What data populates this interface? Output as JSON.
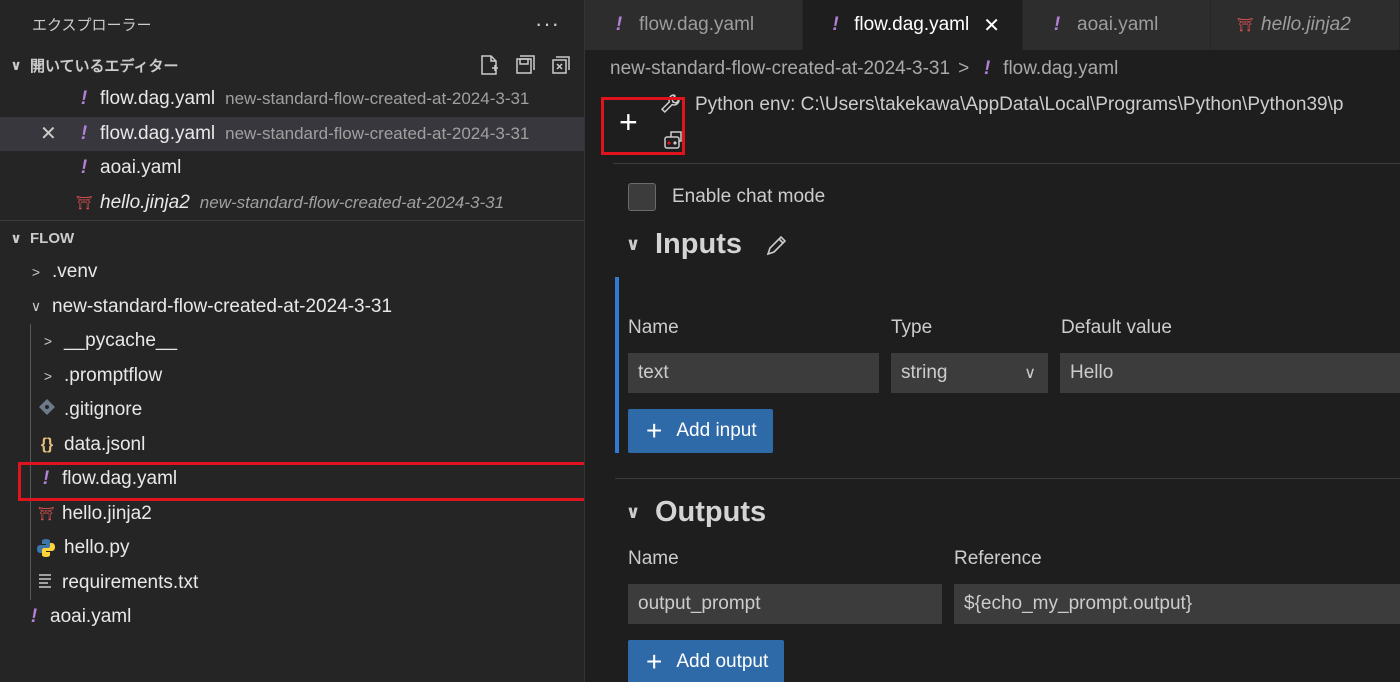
{
  "sidebar": {
    "title": "エクスプローラー",
    "more": "···",
    "open_editors": {
      "label": "開いているエディター",
      "items": [
        {
          "name": "flow.dag.yaml",
          "desc": "new-standard-flow-created-at-2024-3-31",
          "icon": "yaml-icon"
        },
        {
          "name": "flow.dag.yaml",
          "desc": "new-standard-flow-created-at-2024-3-31",
          "icon": "yaml-icon",
          "close": "✕"
        },
        {
          "name": "aoai.yaml",
          "desc": "",
          "icon": "yaml-icon"
        },
        {
          "name": "hello.jinja2",
          "desc": "new-standard-flow-created-at-2024-3-31",
          "icon": "jinja-icon"
        }
      ]
    },
    "flow": {
      "label": "FLOW",
      "items": [
        {
          "name": ".venv"
        },
        {
          "name": "new-standard-flow-created-at-2024-3-31"
        },
        {
          "name": "__pycache__"
        },
        {
          "name": ".promptflow"
        },
        {
          "name": ".gitignore"
        },
        {
          "name": "data.jsonl"
        },
        {
          "name": "flow.dag.yaml"
        },
        {
          "name": "hello.jinja2"
        },
        {
          "name": "hello.py"
        },
        {
          "name": "requirements.txt"
        },
        {
          "name": "aoai.yaml"
        }
      ]
    }
  },
  "editor": {
    "tabs": [
      {
        "label": "flow.dag.yaml"
      },
      {
        "label": "flow.dag.yaml",
        "close": "✕"
      },
      {
        "label": "aoai.yaml"
      },
      {
        "label": "hello.jinja2"
      }
    ],
    "breadcrumb": {
      "folder": "new-standard-flow-created-at-2024-3-31",
      "sep": ">",
      "file": "flow.dag.yaml"
    },
    "env": "Python env: C:\\Users\\takekawa\\AppData\\Local\\Programs\\Python\\Python39\\p",
    "chat_mode_label": "Enable chat mode",
    "inputs": {
      "title": "Inputs",
      "col_name": "Name",
      "col_type": "Type",
      "col_default": "Default value",
      "row": {
        "name": "text",
        "type": "string",
        "default": "Hello"
      },
      "add_label": "Add input"
    },
    "outputs": {
      "title": "Outputs",
      "col_name": "Name",
      "col_reference": "Reference",
      "row": {
        "name": "output_prompt",
        "reference": "${echo_my_prompt.output}"
      },
      "add_label": "Add output"
    }
  },
  "colors": {
    "highlight": "#e0141e",
    "accent": "#2f6aa8",
    "yaml": "#b180d7"
  }
}
